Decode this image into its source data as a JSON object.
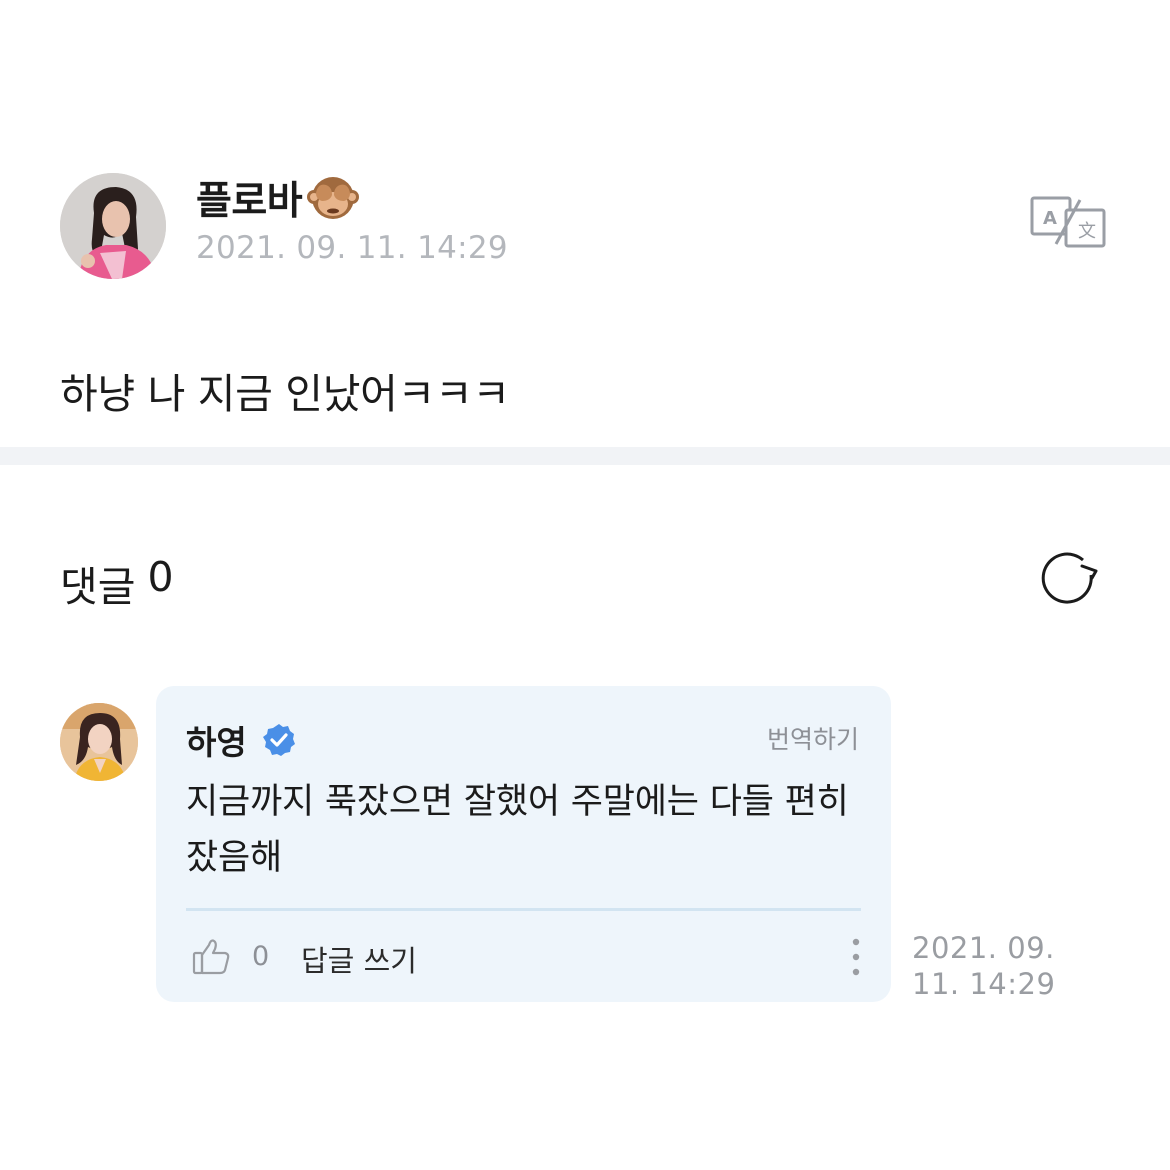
{
  "post": {
    "author_name": "플로바",
    "author_emoji": "see-no-evil-monkey-emoji",
    "date": "2021. 09. 11. 14:29",
    "text": "하냥 나 지금 인났어ㅋㅋㅋ",
    "translate_icon": "translate-icon"
  },
  "comments": {
    "heading": "댓글",
    "count": "0",
    "refresh_icon": "refresh-icon"
  },
  "comment": {
    "author_name": "하영",
    "verified_icon": "verified-badge-icon",
    "translate_label": "번역하기",
    "text": "지금까지 푹잤으면 잘했어 주말에는 다들 편히 잤음해",
    "like_count": "0",
    "reply_label": "답글 쓰기",
    "date": "2021. 09. 11. 14:29"
  },
  "colors": {
    "accent_blue": "#4a8fe7",
    "comment_bg": "#eef5fb",
    "muted_text": "#b4b7bc",
    "divider": "#f1f3f6"
  }
}
